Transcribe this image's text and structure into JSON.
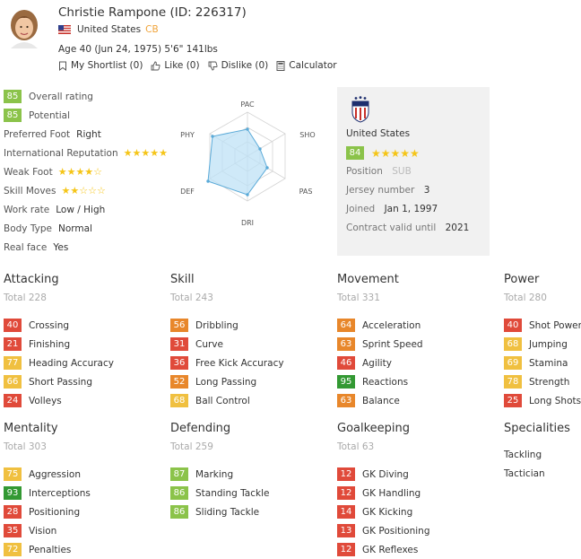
{
  "player": {
    "name_line": "Christie Rampone (ID: 226317)",
    "country": "United States",
    "position": "CB",
    "bio": "Age 40 (Jun 24, 1975) 5'6\" 141lbs"
  },
  "actions": [
    {
      "label": "My Shortlist (0)",
      "icon": "bookmark-icon"
    },
    {
      "label": "Like (0)",
      "icon": "thumbs-up-icon"
    },
    {
      "label": "Dislike (0)",
      "icon": "thumbs-down-icon"
    },
    {
      "label": "Calculator",
      "icon": "calculator-icon"
    }
  ],
  "info": {
    "overall": {
      "value": "85",
      "label": "Overall rating"
    },
    "potential": {
      "value": "85",
      "label": "Potential"
    },
    "preferred_foot": {
      "label": "Preferred Foot",
      "value": "Right"
    },
    "intl_rep": {
      "label": "International Reputation",
      "stars": 5
    },
    "weak_foot": {
      "label": "Weak Foot",
      "stars": 4
    },
    "skill_moves": {
      "label": "Skill Moves",
      "stars": 2
    },
    "work_rate": {
      "label": "Work rate",
      "value": "Low / High"
    },
    "body_type": {
      "label": "Body Type",
      "value": "Normal"
    },
    "real_face": {
      "label": "Real face",
      "value": "Yes"
    }
  },
  "radar": {
    "labels": [
      "PAC",
      "SHO",
      "PAS",
      "DRI",
      "DEF",
      "PHY"
    ]
  },
  "club": {
    "name": "United States",
    "rating": "84",
    "stars": 5,
    "position_label": "Position",
    "position_value": "SUB",
    "jersey_label": "Jersey number",
    "jersey_value": "3",
    "joined_label": "Joined",
    "joined_value": "Jan 1, 1997",
    "contract_label": "Contract valid until",
    "contract_value": "2021"
  },
  "sections": {
    "attacking": {
      "title": "Attacking",
      "total": "Total 228",
      "stats": [
        {
          "v": "40",
          "n": "Crossing"
        },
        {
          "v": "21",
          "n": "Finishing"
        },
        {
          "v": "77",
          "n": "Heading Accuracy"
        },
        {
          "v": "66",
          "n": "Short Passing"
        },
        {
          "v": "24",
          "n": "Volleys"
        }
      ]
    },
    "skill": {
      "title": "Skill",
      "total": "Total 243",
      "stats": [
        {
          "v": "56",
          "n": "Dribbling"
        },
        {
          "v": "31",
          "n": "Curve"
        },
        {
          "v": "36",
          "n": "Free Kick Accuracy"
        },
        {
          "v": "52",
          "n": "Long Passing"
        },
        {
          "v": "68",
          "n": "Ball Control"
        }
      ]
    },
    "movement": {
      "title": "Movement",
      "total": "Total 331",
      "stats": [
        {
          "v": "64",
          "n": "Acceleration"
        },
        {
          "v": "63",
          "n": "Sprint Speed"
        },
        {
          "v": "46",
          "n": "Agility"
        },
        {
          "v": "95",
          "n": "Reactions"
        },
        {
          "v": "63",
          "n": "Balance"
        }
      ]
    },
    "power": {
      "title": "Power",
      "total": "Total 280",
      "stats": [
        {
          "v": "40",
          "n": "Shot Power"
        },
        {
          "v": "68",
          "n": "Jumping"
        },
        {
          "v": "69",
          "n": "Stamina"
        },
        {
          "v": "78",
          "n": "Strength"
        },
        {
          "v": "25",
          "n": "Long Shots"
        }
      ]
    },
    "mentality": {
      "title": "Mentality",
      "total": "Total 303",
      "stats": [
        {
          "v": "75",
          "n": "Aggression"
        },
        {
          "v": "93",
          "n": "Interceptions"
        },
        {
          "v": "28",
          "n": "Positioning"
        },
        {
          "v": "35",
          "n": "Vision"
        },
        {
          "v": "72",
          "n": "Penalties"
        }
      ]
    },
    "defending": {
      "title": "Defending",
      "total": "Total 259",
      "stats": [
        {
          "v": "87",
          "n": "Marking"
        },
        {
          "v": "86",
          "n": "Standing Tackle"
        },
        {
          "v": "86",
          "n": "Sliding Tackle"
        }
      ]
    },
    "goalkeeping": {
      "title": "Goalkeeping",
      "total": "Total 63",
      "stats": [
        {
          "v": "12",
          "n": "GK Diving"
        },
        {
          "v": "12",
          "n": "GK Handling"
        },
        {
          "v": "14",
          "n": "GK Kicking"
        },
        {
          "v": "13",
          "n": "GK Positioning"
        },
        {
          "v": "12",
          "n": "GK Reflexes"
        }
      ]
    },
    "specialities": {
      "title": "Specialities",
      "items": [
        "Tackling",
        "Tactician"
      ]
    }
  },
  "colors": {
    "green_dark": "#339933",
    "green_light": "#8bc34a",
    "yellow": "#f0c040",
    "orange": "#e8872b",
    "red": "#e04a3a",
    "star": "#f5c518",
    "radar_fill": "#bfe1f5",
    "radar_stroke": "#5aaad8"
  }
}
